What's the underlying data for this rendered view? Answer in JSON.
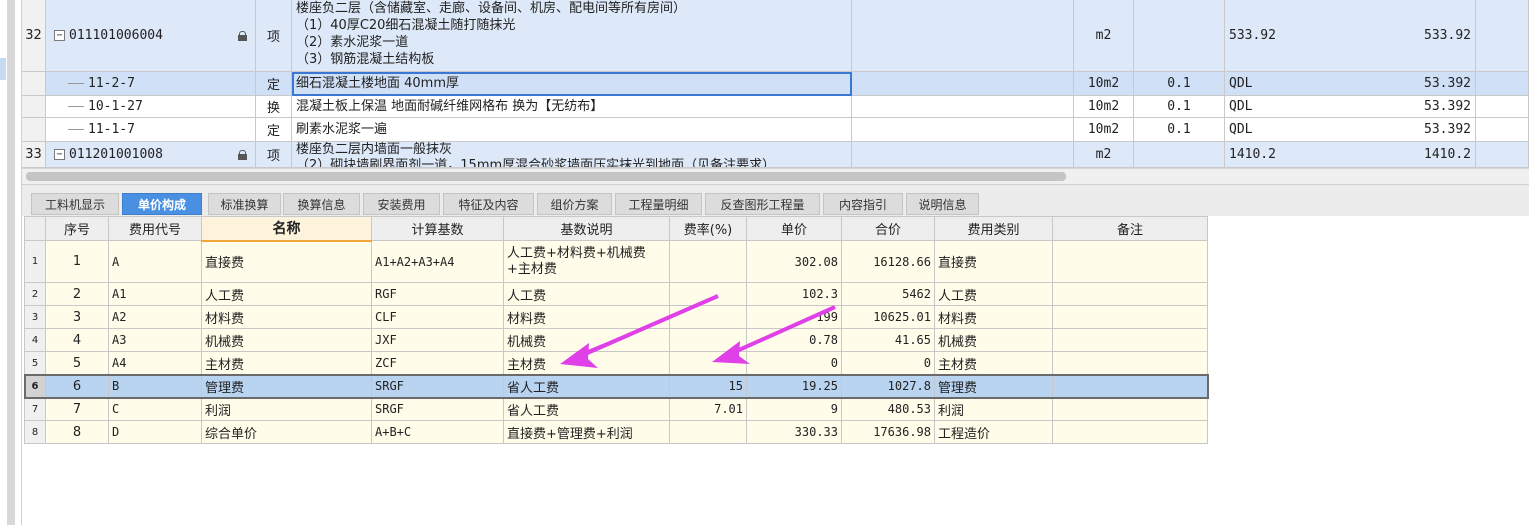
{
  "upper": {
    "rows": [
      {
        "num": "32",
        "code": "011101006004",
        "type": "项",
        "desc": [
          "楼座负二层（含储藏室、走廊、设备间、机房、配电间等所有房间）",
          "（1）40厚C20细石混凝土随打随抹光",
          "（2）素水泥浆一道",
          "（3）钢筋混凝土结构板"
        ],
        "unit": "m2",
        "qty": "",
        "expr": "533.92",
        "amount": "533.92"
      },
      {
        "num": "",
        "code": "11-2-7",
        "type": "定",
        "desc": [
          "细石混凝土楼地面 40mm厚"
        ],
        "unit": "10m2",
        "qty": "0.1",
        "expr": "QDL",
        "amount": "53.392"
      },
      {
        "num": "",
        "code": "10-1-27",
        "type": "换",
        "desc": [
          "混凝土板上保温 地面耐碱纤维网格布  换为【无纺布】"
        ],
        "unit": "10m2",
        "qty": "0.1",
        "expr": "QDL",
        "amount": "53.392"
      },
      {
        "num": "",
        "code": "11-1-7",
        "type": "定",
        "desc": [
          "刷素水泥浆一遍"
        ],
        "unit": "10m2",
        "qty": "0.1",
        "expr": "QDL",
        "amount": "53.392"
      },
      {
        "num": "33",
        "code": "011201001008",
        "type": "项",
        "desc": [
          "楼座负二层内墙面一般抹灰",
          "（2）砌块墙刷界面剂一道，15mm厚混合砂浆墙面压实抹光到地面（见备注要求）"
        ],
        "unit": "m2",
        "qty": "",
        "expr": "1410.2",
        "amount": "1410.2"
      }
    ]
  },
  "tabs": [
    "工料机显示",
    "单价构成",
    "标准换算",
    "换算信息",
    "安装费用",
    "特征及内容",
    "组价方案",
    "工程量明细",
    "反查图形工程量",
    "内容指引",
    "说明信息"
  ],
  "active_tab": "单价构成",
  "lower": {
    "headers": [
      "序号",
      "费用代号",
      "名称",
      "计算基数",
      "基数说明",
      "费率(%)",
      "单价",
      "合价",
      "费用类别",
      "备注"
    ],
    "rows": [
      {
        "rn": "1",
        "seq": "1",
        "code": "A",
        "name": "直接费",
        "base": "A1+A2+A3+A4",
        "base_desc": "人工费+材料费+机械费+主材费",
        "rate": "",
        "price": "302.08",
        "total": "16128.66",
        "cat": "直接费",
        "note": ""
      },
      {
        "rn": "2",
        "seq": "2",
        "code": "A1",
        "name": "人工费",
        "base": "RGF",
        "base_desc": "人工费",
        "rate": "",
        "price": "102.3",
        "total": "5462",
        "cat": "人工费",
        "note": ""
      },
      {
        "rn": "3",
        "seq": "3",
        "code": "A2",
        "name": "材料费",
        "base": "CLF",
        "base_desc": "材料费",
        "rate": "",
        "price": "199",
        "total": "10625.01",
        "cat": "材料费",
        "note": ""
      },
      {
        "rn": "4",
        "seq": "4",
        "code": "A3",
        "name": "机械费",
        "base": "JXF",
        "base_desc": "机械费",
        "rate": "",
        "price": "0.78",
        "total": "41.65",
        "cat": "机械费",
        "note": ""
      },
      {
        "rn": "5",
        "seq": "5",
        "code": "A4",
        "name": "主材费",
        "base": "ZCF",
        "base_desc": "主材费",
        "rate": "",
        "price": "0",
        "total": "0",
        "cat": "主材费",
        "note": ""
      },
      {
        "rn": "6",
        "seq": "6",
        "code": "B",
        "name": "管理费",
        "base": "SRGF",
        "base_desc": "省人工费",
        "rate": "15",
        "price": "19.25",
        "total": "1027.8",
        "cat": "管理费",
        "note": ""
      },
      {
        "rn": "7",
        "seq": "7",
        "code": "C",
        "name": "利润",
        "base": "SRGF",
        "base_desc": "省人工费",
        "rate": "7.01",
        "price": "9",
        "total": "480.53",
        "cat": "利润",
        "note": ""
      },
      {
        "rn": "8",
        "seq": "8",
        "code": "D",
        "name": "综合单价",
        "base": "A+B+C",
        "base_desc": "直接费+管理费+利润",
        "rate": "",
        "price": "330.33",
        "total": "17636.98",
        "cat": "工程造价",
        "note": ""
      }
    ]
  },
  "colors": {
    "arrow": "#e040e8",
    "active_tab": "#4a90e2",
    "selected_row": "#b9d4f1",
    "cell_bg": "#fffde9",
    "upper_row": "#dde8f8"
  }
}
